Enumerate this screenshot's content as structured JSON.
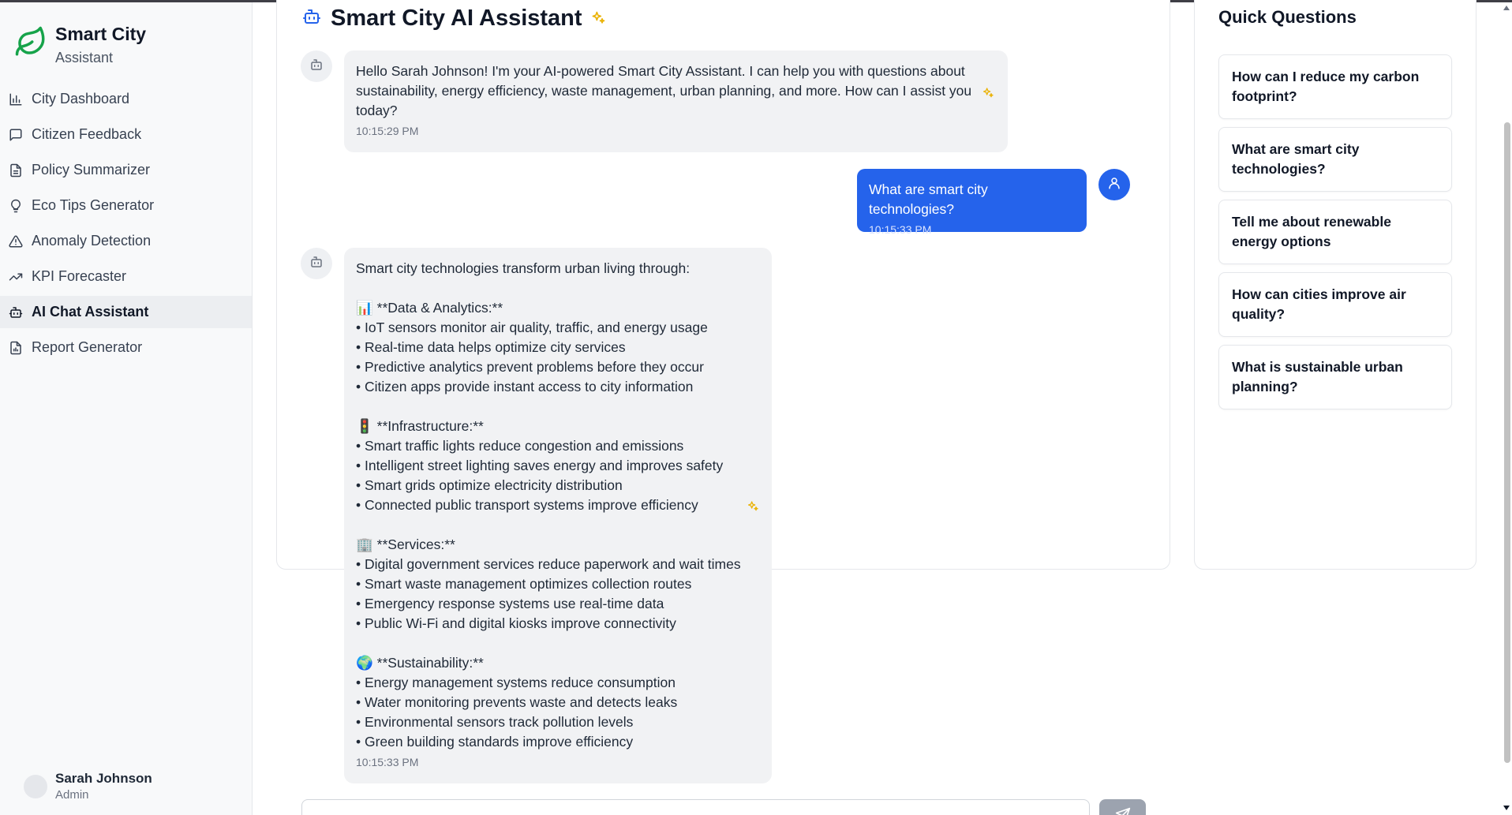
{
  "brand": {
    "title": "Smart City",
    "subtitle": "Assistant"
  },
  "nav": [
    {
      "label": "City Dashboard",
      "icon": "bar-chart-icon",
      "active": false
    },
    {
      "label": "Citizen Feedback",
      "icon": "message-square-icon",
      "active": false
    },
    {
      "label": "Policy Summarizer",
      "icon": "document-icon",
      "active": false
    },
    {
      "label": "Eco Tips Generator",
      "icon": "lightbulb-icon",
      "active": false
    },
    {
      "label": "Anomaly Detection",
      "icon": "warning-triangle-icon",
      "active": false
    },
    {
      "label": "KPI Forecaster",
      "icon": "trending-up-icon",
      "active": false
    },
    {
      "label": "AI Chat Assistant",
      "icon": "bot-icon",
      "active": true
    },
    {
      "label": "Report Generator",
      "icon": "report-icon",
      "active": false
    }
  ],
  "user": {
    "name": "Sarah Johnson",
    "role": "Admin"
  },
  "chat": {
    "title": "Smart City AI Assistant",
    "messages": [
      {
        "role": "assistant",
        "text": "Hello Sarah Johnson! I'm your AI-powered Smart City Assistant. I can help you with questions about sustainability, energy efficiency, waste management, urban planning, and more. How can I assist you today?",
        "time": "10:15:29 PM"
      },
      {
        "role": "user",
        "text": "What are smart city technologies?",
        "time": "10:15:33 PM"
      },
      {
        "role": "assistant",
        "text": "Smart city technologies transform urban living through:\n\n📊 **Data & Analytics:**\n• IoT sensors monitor air quality, traffic, and energy usage\n• Real-time data helps optimize city services\n• Predictive analytics prevent problems before they occur\n• Citizen apps provide instant access to city information\n\n🚦 **Infrastructure:**\n• Smart traffic lights reduce congestion and emissions\n• Intelligent street lighting saves energy and improves safety\n• Smart grids optimize electricity distribution\n• Connected public transport systems improve efficiency\n\n🏢 **Services:**\n• Digital government services reduce paperwork and wait times\n• Smart waste management optimizes collection routes\n• Emergency response systems use real-time data\n• Public Wi-Fi and digital kiosks improve connectivity\n\n🌍 **Sustainability:**\n• Energy management systems reduce consumption\n• Water monitoring prevents waste and detects leaks\n• Environmental sensors track pollution levels\n• Green building standards improve efficiency",
        "time": "10:15:33 PM"
      }
    ],
    "send_icon": "send-icon"
  },
  "quick_questions": {
    "title": "Quick Questions",
    "items": [
      "How can I reduce my carbon footprint?",
      "What are smart city technologies?",
      "Tell me about renewable energy options",
      "How can cities improve air quality?",
      "What is sustainable urban planning?"
    ]
  },
  "colors": {
    "brand_green": "#16a34a",
    "user_bubble": "#2563eb",
    "bot_bubble": "#f1f2f4",
    "sparkle": "#eab308"
  }
}
